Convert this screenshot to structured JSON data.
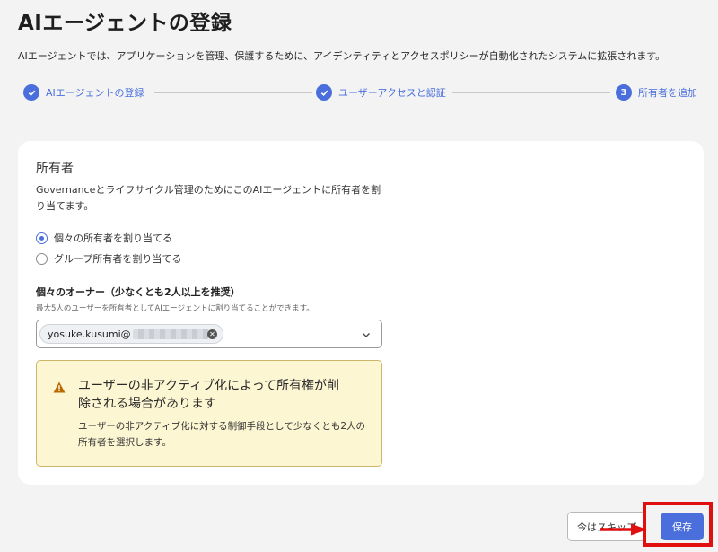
{
  "page": {
    "title": "AIエージェントの登録",
    "description": "AIエージェントでは、アプリケーションを管理、保護するために、アイデンティティとアクセスポリシーが自動化されたシステムに拡張されます。"
  },
  "stepper": {
    "steps": [
      {
        "label": "AIエージェントの登録",
        "state": "done"
      },
      {
        "label": "ユーザーアクセスと認証",
        "state": "done"
      },
      {
        "number": "3",
        "label": "所有者を追加",
        "state": "current"
      }
    ],
    "accent_color": "#4a6fdc"
  },
  "owners_section": {
    "title": "所有者",
    "description": "Governanceとライフサイクル管理のためにこのAIエージェントに所有者を割り当てます。",
    "options": [
      {
        "label": "個々の所有者を割り当てる",
        "checked": true
      },
      {
        "label": "グループ所有者を割り当てる",
        "checked": false
      }
    ],
    "owners_field": {
      "label": "個々のオーナー（少なくとも2人以上を推奨）",
      "hint": "最大5人のユーザーを所有者としてAIエージェントに割り当てることができます。",
      "selected_chip": "yosuke.kusumi@",
      "chip_remove_icon": "close-circle-icon",
      "dropdown_icon": "chevron-down-icon"
    },
    "warning": {
      "icon": "warning-triangle-icon",
      "title": "ユーザーの非アクティブ化によって所有権が削除される場合があります",
      "body": "ユーザーの非アクティブ化に対する制御手段として少なくとも2人の所有者を選択します。",
      "background": "#fdf6d3"
    }
  },
  "footer": {
    "skip_label": "今はスキップ",
    "save_label": "保存"
  }
}
